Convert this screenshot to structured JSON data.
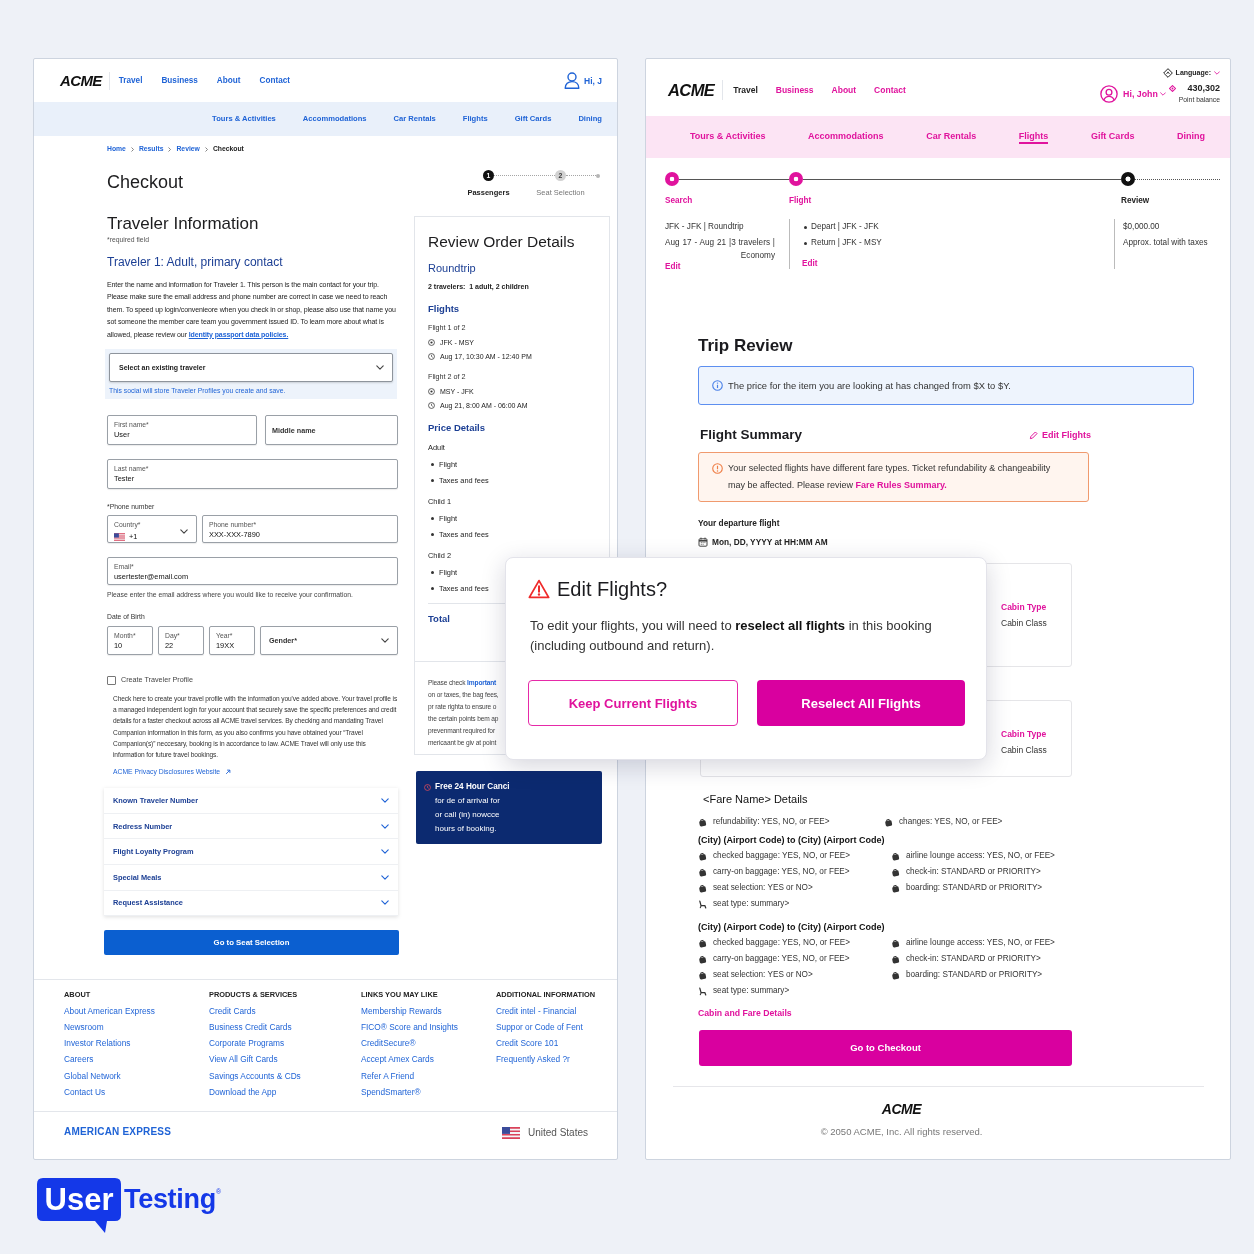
{
  "left_page": {
    "header": {
      "logo": "ACME",
      "nav": [
        "Travel",
        "Business",
        "About",
        "Contact"
      ],
      "greeting": "Hi, J"
    },
    "subnav": [
      "Tours & Activities",
      "Accommodations",
      "Car Rentals",
      "Flights",
      "Gift Cards",
      "Dining"
    ],
    "breadcrumb": [
      {
        "label": "Home",
        "selected": false
      },
      {
        "label": "Results",
        "selected": false
      },
      {
        "label": "Review",
        "selected": false
      },
      {
        "label": "Checkout",
        "selected": true
      }
    ],
    "title": "Checkout",
    "steps": [
      {
        "number": "1",
        "label": "Passengers",
        "selected": true
      },
      {
        "number": "2",
        "label": "Seat Selection",
        "selected": false
      }
    ],
    "traveler_form": {
      "heading": "Traveler Information",
      "required_note": "*required field",
      "subheading": "Traveler 1: Adult, primary contact",
      "intro": "Enter the name and information for Traveler 1. This person is the main contact for your trip. Please make sure the email address and phone number are correct in case we need to reach them. To speed up login/convenieore when you check in or shop, please also use that name you sot someone the member care team you government issued ID. To learn more about what is allowed, please review our",
      "intro_link": "Identity passport data policies.",
      "traveler_select": {
        "placeholder": "Select an existing traveler",
        "hint": "This social will store Traveler Profiles you create and save."
      },
      "rows": [
        {
          "fields": [
            {
              "kind": "text",
              "label": "First name*",
              "value": "User"
            },
            {
              "kind": "text",
              "placeholder": "Middle name"
            }
          ]
        },
        {
          "fields": [
            {
              "kind": "text",
              "label": "Last name*",
              "value": "Tester"
            }
          ]
        },
        {
          "label": "*Phone number",
          "fields": [
            {
              "kind": "country",
              "label": "Country*",
              "value": "+1"
            },
            {
              "kind": "text",
              "label": "Phone number*",
              "value": "XXX-XXX-7890"
            }
          ]
        },
        {
          "fields": [
            {
              "kind": "text",
              "label": "Email*",
              "value": "usertester@email.com"
            }
          ],
          "hint": "Please enter the email address where you would like to receive your confirmation."
        },
        {
          "label": "Date of Birth",
          "fields": [
            {
              "kind": "text",
              "label": "Month*",
              "value": "10"
            },
            {
              "kind": "text",
              "label": "Day*",
              "value": "22"
            },
            {
              "kind": "text",
              "label": "Year*",
              "value": "19XX"
            },
            {
              "kind": "select",
              "placeholder": "Gender*"
            }
          ]
        }
      ],
      "profile_checkbox": {
        "label": "Create Traveler Profile",
        "checked": false,
        "description": "Check here to create your travel profile with the information you've added above. Your travel profile is a managed independent login for your account that securely save the specific preferences and credit details for a faster checkout across all ACME travel services. By checking and mandating Travel Companion information in this form, as you also confirms you have obtained your “Travel Companion(s)” neccesary, booking is in accordance to law. ACME Travel will only use this information for future travel bookings.",
        "link": "ACME Privacy Disclosures Website"
      },
      "sections": [
        {
          "label": "Known Traveler Number",
          "expanded": false
        },
        {
          "label": "Redress Number",
          "expanded": false
        },
        {
          "label": "Flight Loyalty Program",
          "expanded": false
        },
        {
          "label": "Special Meals",
          "expanded": false
        },
        {
          "label": "Request Assistance",
          "expanded": false
        }
      ],
      "submit": "Go to Seat Selection"
    },
    "review_order": {
      "title": "Review Order Details",
      "trip_type": "Roundtrip",
      "travelers": "2 travelers:  1 adult, 2 children",
      "flights_heading": "Flights",
      "flights": [
        {
          "title": "Flight 1 of 2",
          "route": "JFK - MSY",
          "time": "Aug 17, 10:30 AM - 12:40 PM"
        },
        {
          "title": "Flight 2 of 2",
          "route": "MSY - JFK",
          "time": "Aug 21, 8:00 AM - 06:00 AM"
        }
      ],
      "price_heading": "Price Details",
      "price_groups": [
        {
          "title": "Adult",
          "items": [
            "Flight",
            "Taxes and fees"
          ]
        },
        {
          "title": "Child 1",
          "items": [
            "Flight",
            "Taxes and fees"
          ]
        },
        {
          "title": "Child 2",
          "items": [
            "Flight",
            "Taxes and fees"
          ]
        }
      ],
      "total": "Total",
      "note_start": "Please check",
      "note_link": "Important",
      "note_lines": [
        "on or taxes, the bag fees,",
        "pr rate righta to ensure o",
        "the certain points bem ap",
        "prevenmant required for",
        "mericaant be giv at point"
      ]
    },
    "cancellation_notice": {
      "title": "Free 24 Hour Canci",
      "lines": [
        "for de of arrival for",
        "or call (in) nowcce",
        "hours of booking."
      ]
    },
    "footer": {
      "columns": [
        {
          "heading": "ABOUT",
          "links": [
            "About American Express",
            "Newsroom",
            "Investor Relations",
            "Careers",
            "Global Network",
            "Contact Us"
          ]
        },
        {
          "heading": "PRODUCTS & SERVICES",
          "links": [
            "Credit Cards",
            "Business Credit Cards",
            "Corporate Programs",
            "View All Gift Cards",
            "Savings Accounts & CDs",
            "Download the App"
          ]
        },
        {
          "heading": "LINKS YOU MAY LIKE",
          "links": [
            "Membership Rewards",
            "FICO® Score and Insights",
            "CreditSecure®",
            "Accept Amex Cards",
            "Refer A Friend",
            "SpendSmarter®"
          ]
        },
        {
          "heading": "ADDITIONAL INFORMATION",
          "links": [
            "Credit intel - Financial",
            "Suppor or Code of Fent",
            "Credit Score 101",
            "Frequently Asked ?r"
          ]
        }
      ],
      "brand": "AMERICAN EXPRESS",
      "country": "United States"
    }
  },
  "right_page": {
    "header": {
      "logo": "ACME",
      "nav": [
        {
          "label": "Travel",
          "selected": true
        },
        {
          "label": "Business",
          "selected": false
        },
        {
          "label": "About",
          "selected": false
        },
        {
          "label": "Contact",
          "selected": false
        }
      ],
      "language": "Language:",
      "greeting": "Hi, John",
      "points": "430,302",
      "points_label": "Point balance"
    },
    "subnav": [
      {
        "label": "Tours & Activities",
        "selected": false
      },
      {
        "label": "Accommodations",
        "selected": false
      },
      {
        "label": "Car Rentals",
        "selected": false
      },
      {
        "label": "Flights",
        "selected": true
      },
      {
        "label": "Gift Cards",
        "selected": false
      },
      {
        "label": "Dining",
        "selected": false
      }
    ],
    "steps": [
      {
        "label": "Search",
        "selected": false,
        "lines": [
          "JFK - JFK | Roundtrip",
          "Aug 17 - Aug 21 |3 travelers | Economy"
        ],
        "action": "Edit"
      },
      {
        "label": "Flight",
        "selected": false,
        "bullets": [
          "Depart | JFK - JFK",
          "Return | JFK - MSY"
        ],
        "action": "Edit"
      },
      {
        "label": "Review",
        "selected": true,
        "lines": [
          "$0,000.00",
          "Approx. total with taxes"
        ]
      }
    ],
    "trip_review": {
      "title": "Trip Review",
      "notice": "The price for the item you are looking at has changed from $X to $Y."
    },
    "flight_summary": {
      "title": "Flight Summary",
      "edit": "Edit Flights",
      "warning": "Your selected flights have different fare types. Ticket refundability & changeability may be affected. Please review",
      "warning_link": "Fare Rules Summary.",
      "departure_label": "Your departure flight",
      "departure_date": "Mon, DD, YYYY at HH:MM AM",
      "cabins": [
        {
          "title": "Cabin Type",
          "value": "Cabin Class"
        },
        {
          "title": "Cabin Type",
          "value": "Cabin Class"
        }
      ]
    },
    "fare_details": {
      "title": "<Fare Name> Details",
      "general": [
        {
          "kind": "bag",
          "text": "refundability: YES, NO, or FEE>"
        },
        {
          "kind": "bag",
          "text": "changes: YES, NO, or FEE>"
        }
      ],
      "segments": [
        {
          "route": "(City) (Airport Code) to (City) (Airport Code)",
          "items": [
            {
              "kind": "bag",
              "text": "checked baggage: YES, NO, or FEE>"
            },
            {
              "kind": "bag",
              "text": "airline lounge access: YES, NO, or FEE>"
            },
            {
              "kind": "bag",
              "text": "carry-on baggage: YES, NO, or FEE>"
            },
            {
              "kind": "bag",
              "text": "check-in: STANDARD or PRIORITY>"
            },
            {
              "kind": "bag",
              "text": "seat selection: YES or NO>"
            },
            {
              "kind": "bag",
              "text": "boarding: STANDARD or PRIORITY>"
            },
            {
              "kind": "seat",
              "text": "seat type: summary>"
            }
          ]
        },
        {
          "route": "(City) (Airport Code) to (City) (Airport Code)",
          "items": [
            {
              "kind": "bag",
              "text": "checked baggage: YES, NO, or FEE>"
            },
            {
              "kind": "bag",
              "text": "airline lounge access: YES, NO, or FEE>"
            },
            {
              "kind": "bag",
              "text": "carry-on baggage: YES, NO, or FEE>"
            },
            {
              "kind": "bag",
              "text": "check-in: STANDARD or PRIORITY>"
            },
            {
              "kind": "bag",
              "text": "seat selection: YES or NO>"
            },
            {
              "kind": "bag",
              "text": "boarding: STANDARD or PRIORITY>"
            },
            {
              "kind": "seat",
              "text": "seat type: summary>"
            }
          ]
        }
      ],
      "link": "Cabin and Fare Details"
    },
    "checkout_button": "Go to Checkout",
    "footer": {
      "logo": "ACME",
      "copyright": "© 2050 ACME, Inc. All rights reserved."
    }
  },
  "dialog": {
    "title": "Edit Flights?",
    "body": "To edit your flights, you will need to **reselect all flights** in this booking (including outbound and return).",
    "buttons": [
      {
        "kind": "secondary",
        "label": "Keep Current Flights"
      },
      {
        "kind": "primary",
        "label": "Reselect All Flights"
      }
    ]
  },
  "brand_logo": {
    "boxed": "User",
    "text": "Testing",
    "mark": "®"
  }
}
